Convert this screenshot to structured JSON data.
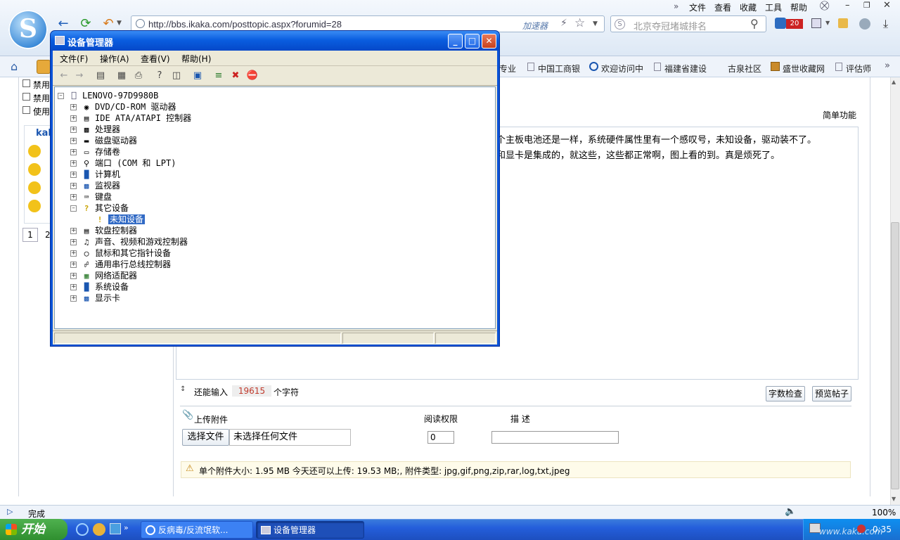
{
  "browser": {
    "address": "http://bbs.ikaka.com/posttopic.aspx?forumid=28",
    "accelerator": "加速器",
    "search_placeholder": "北京夺冠堵城排名",
    "badge_count": "20",
    "menus": [
      "文件",
      "查看",
      "收藏",
      "工具",
      "帮助"
    ],
    "bookmarks": [
      "专业",
      "中国工商银",
      "欢迎访问中",
      "福建省建设",
      "古泉社区",
      "盛世收藏网",
      "评估师"
    ]
  },
  "page": {
    "checkboxes": [
      "禁用",
      "禁用",
      "使用"
    ],
    "user_label": "kak",
    "page_num_1": "1",
    "page_num_2": "2",
    "simple_mode": "简单功能",
    "post_line1": "个主板电池还是一样，系统硬件属性里有一个感叹号，未知设备，驱动装不了。",
    "post_line2": "和显卡是集成的，就这些，这些都正常啊，图上看的到。真是烦死了。",
    "remaining_prefix": "还能输入",
    "remaining_count": "19615",
    "remaining_suffix": "个字符",
    "word_check": "字数检查",
    "preview": "预览帖子",
    "upload_label": "上传附件",
    "read_perm": "阅读权限",
    "description": "描 述",
    "choose_file": "选择文件",
    "no_file": "未选择任何文件",
    "perm_value": "0",
    "attach_info": "单个附件大小: 1.95 MB  今天还可以上传: 19.53 MB;,  附件类型: jpg,gif,png,zip,rar,log,txt,jpeg"
  },
  "status": {
    "text": "完成",
    "zoom": "100%"
  },
  "taskbar": {
    "start": "开始",
    "task1": "反病毒/反流氓软...",
    "task2": "设备管理器",
    "watermark": "www.kaka.com",
    "time": "0:35"
  },
  "device_manager": {
    "title": "设备管理器",
    "menu": [
      "文件(F)",
      "操作(A)",
      "查看(V)",
      "帮助(H)"
    ],
    "root": "LENOVO-97D9980B",
    "items": [
      "DVD/CD-ROM 驱动器",
      "IDE ATA/ATAPI 控制器",
      "处理器",
      "磁盘驱动器",
      "存储卷",
      "端口 (COM 和 LPT)",
      "计算机",
      "监视器",
      "键盘",
      "其它设备",
      "未知设备",
      "软盘控制器",
      "声音、视频和游戏控制器",
      "鼠标和其它指针设备",
      "通用串行总线控制器",
      "网络适配器",
      "系统设备",
      "显示卡"
    ]
  }
}
